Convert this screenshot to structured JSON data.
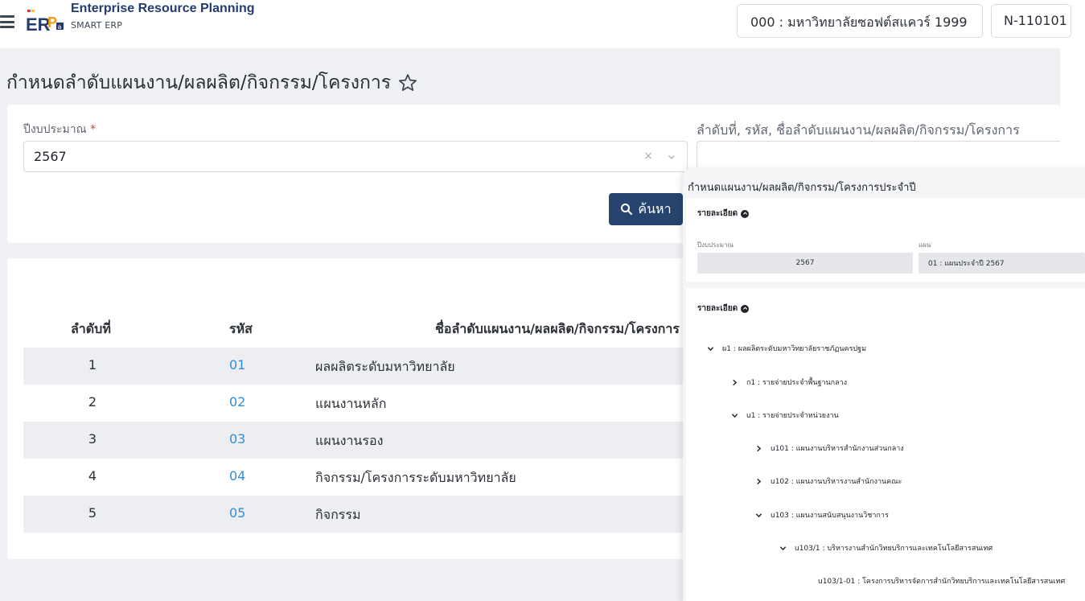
{
  "header": {
    "brand_title": "Enterprise Resource Planning",
    "brand_sub": "SMART ERP",
    "org": "000 : มหาวิทยาลัยซอฟต์สแควร์ 1999",
    "user": "N-110101"
  },
  "page": {
    "title": "กำหนดลำดับแผนงาน/ผลผลิต/กิจกรรม/โครงการ"
  },
  "filter": {
    "year_label": "ปีงบประมาณ",
    "required_mark": "*",
    "year_value": "2567",
    "clear_symbol": "×",
    "search_label": "ลำดับที่, รหัส, ชื่อลำดับแผนงาน/ผลผลิต/กิจกรรม/โครงการ",
    "search_value": "",
    "search_button": "ค้นหา"
  },
  "table": {
    "headers": [
      "ลำดับที่",
      "รหัส",
      "ชื่อลำดับแผนงาน/ผลผลิต/กิจกรรม/โครงการ"
    ],
    "rows": [
      {
        "no": "1",
        "code": "01",
        "name": "ผลผลิตระดับมหาวิทยาลัย"
      },
      {
        "no": "2",
        "code": "02",
        "name": "แผนงานหลัก"
      },
      {
        "no": "3",
        "code": "03",
        "name": "แผนงานรอง"
      },
      {
        "no": "4",
        "code": "04",
        "name": "กิจกรรม/โครงการระดับมหาวิทยาลัย"
      },
      {
        "no": "5",
        "code": "05",
        "name": "กิจกรรม"
      }
    ]
  },
  "overlay": {
    "title": "กำหนดแผนงาน/ผลผลิต/กิจกรรม/โครงการประจำปี",
    "section1_title": "รายละเอียด",
    "year_label": "ปีงบประมาณ",
    "year_value": "2567",
    "plan_label": "แผน",
    "plan_value": "01 : แผนประจำปี 2567",
    "section2_title": "รายละเอียด",
    "tree": [
      {
        "label": "ผ1 : ผลผลิตระดับมหาวิทยาลัยราชภัฏนครปฐม",
        "state": "expanded"
      },
      {
        "label": "ก1 : รายจ่ายประจำพื้นฐานกลาง",
        "state": "collapsed"
      },
      {
        "label": "u1 : รายจ่ายประจำหน่วยงาน",
        "state": "expanded"
      },
      {
        "label": "u101 : แผนงานบริหารสำนักงานส่วนกลาง",
        "state": "collapsed"
      },
      {
        "label": "u102 : แผนงานบริหารงานสำนักงานคณะ",
        "state": "collapsed"
      },
      {
        "label": "u103 : แผนงานสนับสนุนงานวิชาการ",
        "state": "expanded"
      },
      {
        "label": "u103/1 : บริหารงานสำนักวิทยบริการและเทคโนโลยีสารสนเทศ",
        "state": "expanded"
      },
      {
        "label": "u103/1-01 : โครงการบริหารจัดการสำนักวิทยบริการและเทคโนโลยีสารสนเทศ",
        "state": "leaf"
      }
    ]
  },
  "colors": {
    "primary": "#26446e",
    "link": "#2f8fd6",
    "page_bg": "#eef0f3",
    "row_alt": "#eceef1"
  },
  "icons": [
    "menu-icon",
    "erp-logo",
    "star-icon",
    "search-icon",
    "clear-icon",
    "chevron-down-icon",
    "chevron-right-icon",
    "chevron-up-circle-icon"
  ]
}
